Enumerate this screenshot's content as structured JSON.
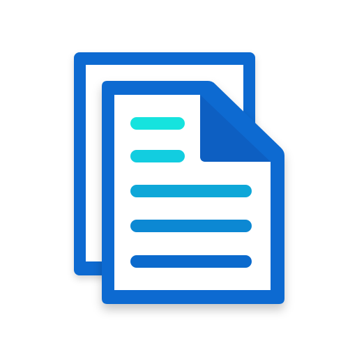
{
  "icon": {
    "name": "documents-icon",
    "colors": {
      "frame": "#0A6BD1",
      "frame_dark": "#095EC2",
      "paper": "#FFFFFF",
      "line_1": "#16E3DE",
      "line_2": "#12CDE0",
      "line_3": "#0EA7D8",
      "line_4": "#0C88D3",
      "line_5": "#0B6ACD"
    }
  }
}
